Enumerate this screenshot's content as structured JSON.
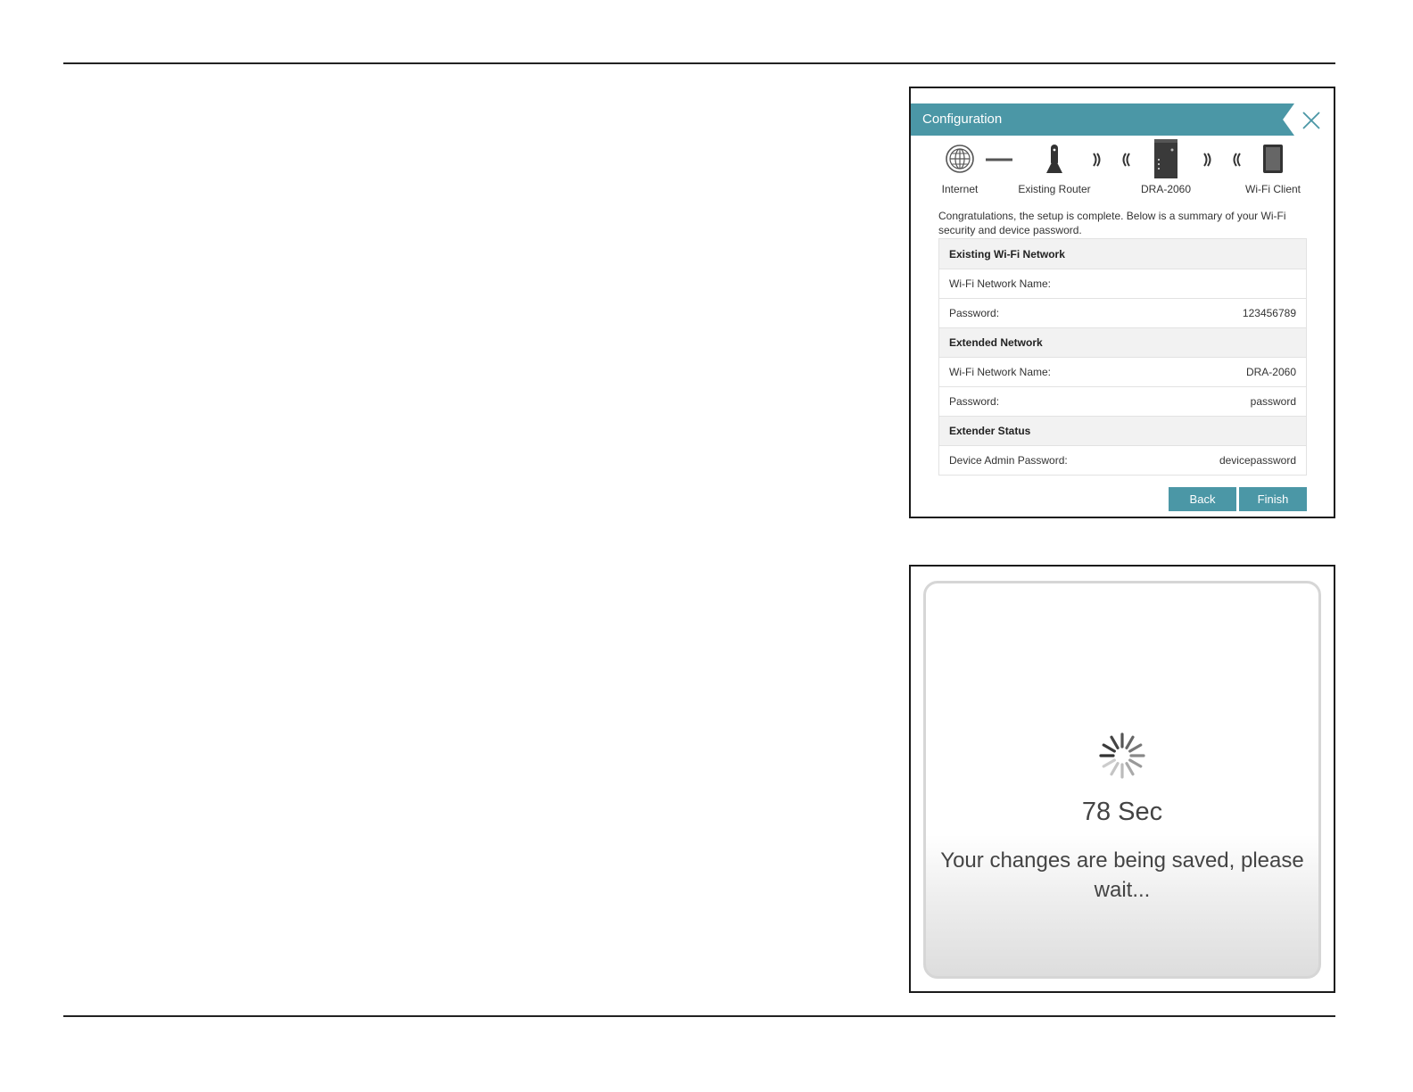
{
  "config": {
    "title": "Configuration",
    "diagram": {
      "internet": "Internet",
      "router": "Existing Router",
      "extender": "DRA-2060",
      "client": "Wi-Fi Client"
    },
    "intro": "Congratulations, the setup is complete. Below is a summary of your Wi-Fi security and device password.",
    "sections": {
      "existing": {
        "title": "Existing Wi-Fi Network",
        "name_label": "Wi-Fi Network Name:",
        "name_value": "",
        "password_label": "Password:",
        "password_value": "123456789"
      },
      "extended": {
        "title": "Extended Network",
        "name_label": "Wi-Fi Network Name:",
        "name_value": "DRA-2060",
        "password_label": "Password:",
        "password_value": "password"
      },
      "status": {
        "title": "Extender Status",
        "admin_label": "Device Admin Password:",
        "admin_value": "devicepassword"
      }
    },
    "buttons": {
      "back": "Back",
      "finish": "Finish"
    }
  },
  "saving": {
    "seconds": "78 Sec",
    "message": "Your changes are being saved, please wait..."
  },
  "colors": {
    "accent": "#4b97a6"
  }
}
